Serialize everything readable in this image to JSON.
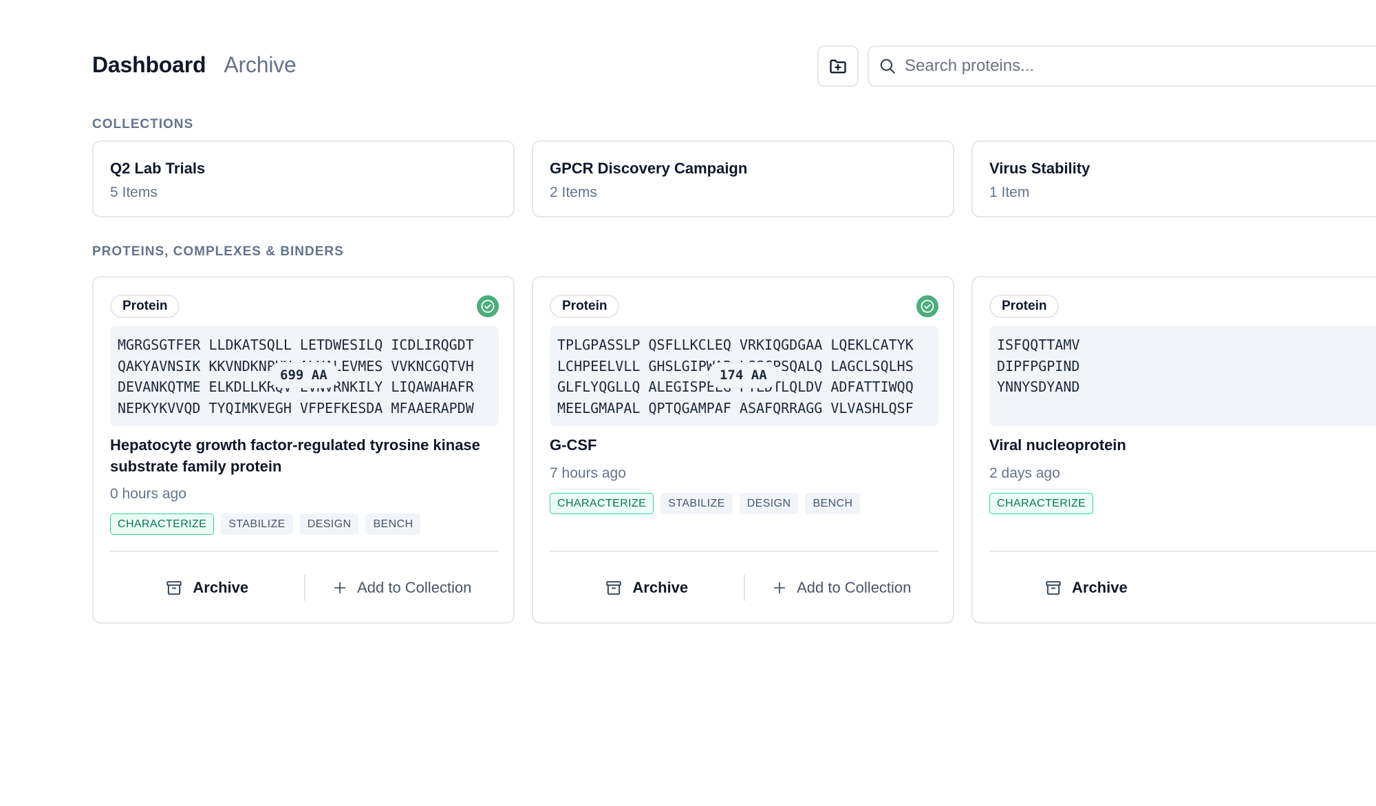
{
  "nav": {
    "tabs": [
      {
        "label": "Dashboard"
      },
      {
        "label": "Archive"
      }
    ]
  },
  "search": {
    "placeholder": "Search proteins..."
  },
  "sections": {
    "collections": "COLLECTIONS",
    "proteins": "PROTEINS, COMPLEXES & BINDERS"
  },
  "collections": [
    {
      "title": "Q2 Lab Trials",
      "count": "5 Items"
    },
    {
      "title": "GPCR Discovery Campaign",
      "count": "2 Items"
    },
    {
      "title": "Virus Stability",
      "count": "1 Item"
    }
  ],
  "proteins": [
    {
      "badge": "Protein",
      "sequence": [
        "MGRGSGTFER LLDKATSQLL LETDWESILQ ICDLIRQGDT",
        "QAKYAVNSIK KKVNDKNPHV ALYALEVMES VVKNCGQTVH",
        "DEVANKQTME ELKDLLKRQV EVNVRNKILY LIQAWAHAFR",
        "NEPKYKVVQD TYQIMKVEGH VFPEFKESDA MFAAERAPDW"
      ],
      "length": "699 AA",
      "name": "Hepatocyte growth factor-regulated tyrosine kinase substrate family protein",
      "time": "0 hours ago",
      "tags": [
        "CHARACTERIZE",
        "STABILIZE",
        "DESIGN",
        "BENCH"
      ],
      "archive_label": "Archive",
      "add_label": "Add to Collection"
    },
    {
      "badge": "Protein",
      "sequence": [
        "TPLGPASSLP QSFLLKCLEQ VRKIQGDGAA LQEKLCATYK",
        "LCHPEELVLL GHSLGIPWAP LSSCPSQALQ LAGCLSQLHS",
        "GLFLYQGLLQ ALEGISPELG PTLDTLQLDV ADFATTIWQQ",
        "MEELGMAPAL QPTQGAMPAF ASAFQRRAGG VLVASHLQSF"
      ],
      "length": "174 AA",
      "name": "G-CSF",
      "time": "7 hours ago",
      "tags": [
        "CHARACTERIZE",
        "STABILIZE",
        "DESIGN",
        "BENCH"
      ],
      "archive_label": "Archive",
      "add_label": "Add to Collection"
    },
    {
      "badge": "Protein",
      "sequence": [
        "ISFQQTTAMV",
        "DIPFPGPIND",
        "YNNYSDYAND"
      ],
      "length": "",
      "name": "Viral nucleoprotein",
      "time": "2 days ago",
      "tags": [
        "CHARACTERIZE"
      ],
      "archive_label": "Archive",
      "add_label": ""
    }
  ],
  "colors": {
    "accent_green": "#4cae7c",
    "tag_primary_bg": "#ecfdf5",
    "tag_primary_text": "#047857",
    "border": "#e5e7eb",
    "muted_text": "#64748b"
  },
  "icons": {
    "new_collection": "folder-plus-icon",
    "search": "search-icon",
    "status": "check-circle-icon",
    "archive": "archive-box-icon",
    "add": "plus-icon"
  }
}
